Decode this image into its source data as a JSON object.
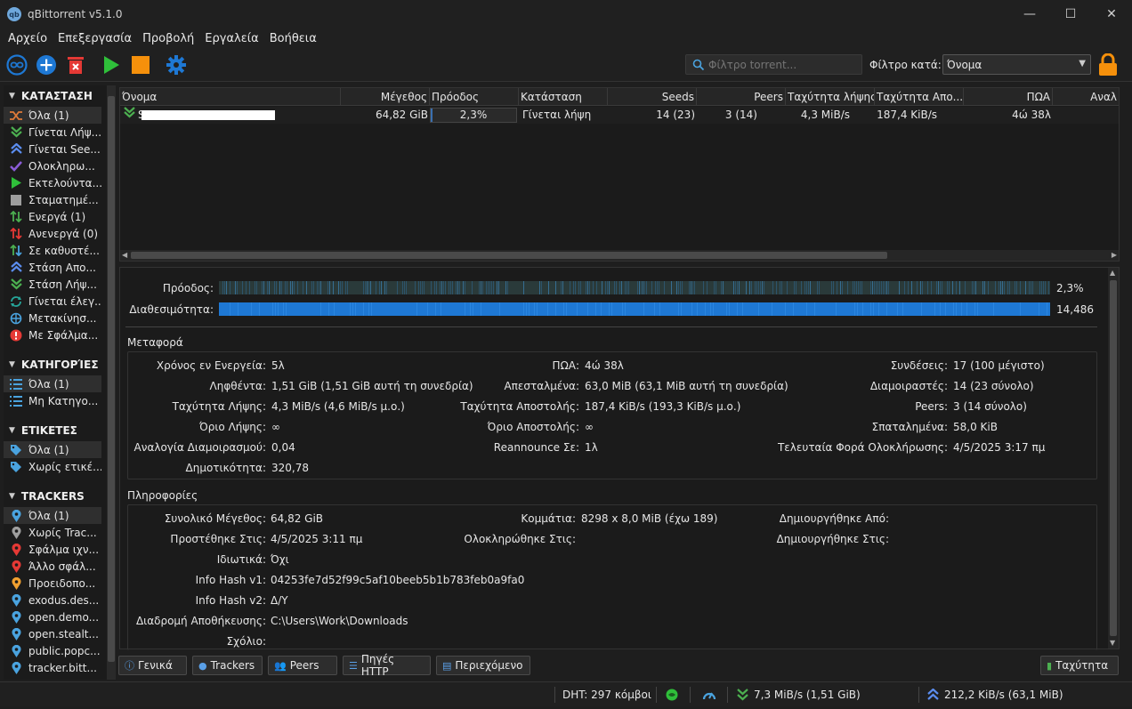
{
  "window": {
    "title": "qBittorrent v5.1.0",
    "icon_text": "qb",
    "minimize": "—",
    "maximize": "☐",
    "close": "✕"
  },
  "menu": [
    "Αρχείο",
    "Επεξεργασία",
    "Προβολή",
    "Εργαλεία",
    "Βοήθεια"
  ],
  "toolbar": {
    "search_placeholder": "Φίλτρο torrent...",
    "filter_label": "Φίλτρο κατά:",
    "filter_value": "Όνομα"
  },
  "sidebar": {
    "status_header": "ΚΑΤΑΣΤΑΣΗ",
    "status_items": [
      {
        "label": "Όλα (1)",
        "icon": "shuffle-icon",
        "color": "#e07b39"
      },
      {
        "label": "Γίνεται Λήψ...",
        "icon": "download-icon",
        "color": "#4caf50"
      },
      {
        "label": "Γίνεται See...",
        "icon": "upload-icon",
        "color": "#5b8def"
      },
      {
        "label": "Ολοκληρω...",
        "icon": "check-icon",
        "color": "#8a5cd6"
      },
      {
        "label": "Εκτελούντα...",
        "icon": "play-icon",
        "color": "#2fbf3a"
      },
      {
        "label": "Σταματημέ...",
        "icon": "stop-icon",
        "color": "#9e9e9e"
      },
      {
        "label": "Ενεργά (1)",
        "icon": "updown-active-icon",
        "color": "#4caf50"
      },
      {
        "label": "Ανενεργά (0)",
        "icon": "updown-inactive-icon",
        "color": "#e53935"
      },
      {
        "label": "Σε καθυστέ...",
        "icon": "updown-stalled-icon",
        "color": "#4aa3df"
      },
      {
        "label": "Στάση Απο...",
        "icon": "stalled-upload-icon",
        "color": "#5b8def"
      },
      {
        "label": "Στάση Λήψ...",
        "icon": "stalled-download-icon",
        "color": "#4caf50"
      },
      {
        "label": "Γίνεται έλεγ...",
        "icon": "refresh-icon",
        "color": "#26a69a"
      },
      {
        "label": "Μετακίνησ...",
        "icon": "move-icon",
        "color": "#4aa3df"
      },
      {
        "label": "Με Σφάλμα...",
        "icon": "error-icon",
        "color": "#e53935"
      }
    ],
    "categories_header": "ΚΑΤΗΓΟΡΊΕΣ",
    "category_items": [
      {
        "label": "Όλα (1)"
      },
      {
        "label": "Μη Κατηγο..."
      }
    ],
    "tags_header": "ΕΤΙΚΕΤΕΣ",
    "tag_items": [
      {
        "label": "Όλα (1)"
      },
      {
        "label": "Χωρίς ετικέ..."
      }
    ],
    "trackers_header": "TRACKERS",
    "tracker_items": [
      {
        "label": "Όλα (1)",
        "color": "#4aa3df"
      },
      {
        "label": "Χωρίς Trac...",
        "color": "#9e9e9e"
      },
      {
        "label": "Σφάλμα ιχν...",
        "color": "#e53935"
      },
      {
        "label": "Άλλο σφάλ...",
        "color": "#e53935"
      },
      {
        "label": "Προειδοπο...",
        "color": "#f0a030"
      },
      {
        "label": "exodus.des...",
        "color": "#4aa3df"
      },
      {
        "label": "open.demo...",
        "color": "#4aa3df"
      },
      {
        "label": "open.stealt...",
        "color": "#4aa3df"
      },
      {
        "label": "public.popc...",
        "color": "#4aa3df"
      },
      {
        "label": "tracker.bitt...",
        "color": "#4aa3df"
      }
    ]
  },
  "torrent_list": {
    "columns": [
      "Όνομα",
      "Μέγεθος",
      "Πρόοδος",
      "Κατάσταση",
      "Seeds",
      "Peers",
      "Ταχύτητα λήψης",
      "Ταχύτητα Απο...",
      "ΠΩΑ",
      "Αναλ"
    ],
    "rows": [
      {
        "name_prefix": "S",
        "size": "64,82 GiB",
        "progress": "2,3%",
        "progress_fraction": 0.023,
        "status": "Γίνεται λήψη",
        "seeds": "14 (23)",
        "peers": "3 (14)",
        "down_speed": "4,3 MiB/s",
        "up_speed": "187,4 KiB/s",
        "eta": "4ώ 38λ"
      }
    ]
  },
  "details": {
    "progress_label": "Πρόοδος:",
    "progress_value": "2,3%",
    "availability_label": "Διαθεσιμότητα:",
    "availability_value": "14,486",
    "transfer_title": "Μεταφορά",
    "transfer": {
      "col1": [
        {
          "label": "Χρόνος εν Ενεργεία:",
          "value": "5λ"
        },
        {
          "label": "Ληφθέντα:",
          "value": "1,51 GiB (1,51 GiB αυτή τη συνεδρία)"
        },
        {
          "label": "Ταχύτητα Λήψης:",
          "value": "4,3 MiB/s (4,6 MiB/s μ.ο.)"
        },
        {
          "label": "Όριο Λήψης:",
          "value": "∞"
        },
        {
          "label": "Αναλογία Διαμοιρασμού:",
          "value": "0,04"
        },
        {
          "label": "Δημοτικότητα:",
          "value": "320,78"
        }
      ],
      "col2": [
        {
          "label": "ΠΩΑ:",
          "value": "4ώ 38λ"
        },
        {
          "label": "Απεσταλμένα:",
          "value": "63,0 MiB (63,1 MiB αυτή τη συνεδρία)"
        },
        {
          "label": "Ταχύτητα Αποστολής:",
          "value": "187,4 KiB/s (193,3 KiB/s μ.ο.)"
        },
        {
          "label": "Όριο Αποστολής:",
          "value": "∞"
        },
        {
          "label": "Reannounce Σε:",
          "value": "1λ"
        }
      ],
      "col3": [
        {
          "label": "Συνδέσεις:",
          "value": "17 (100 μέγιστο)"
        },
        {
          "label": "Διαμοιραστές:",
          "value": "14 (23 σύνολο)"
        },
        {
          "label": "Peers:",
          "value": "3 (14 σύνολο)"
        },
        {
          "label": "Σπαταλημένα:",
          "value": "58,0 KiB"
        },
        {
          "label": "Τελευταία Φορά Ολοκλήρωσης:",
          "value": "4/5/2025 3:17 πμ"
        }
      ]
    },
    "info_title": "Πληροφορίες",
    "info": {
      "col1": [
        {
          "label": "Συνολικό Μέγεθος:",
          "value": "64,82 GiB"
        },
        {
          "label": "Προστέθηκε Στις:",
          "value": "4/5/2025 3:11 πμ"
        },
        {
          "label": "Ιδιωτικά:",
          "value": "Όχι"
        },
        {
          "label": "Info Hash v1:",
          "value": "04253fe7d52f99c5af10beeb5b1b783feb0a9fa0"
        },
        {
          "label": "Info Hash v2:",
          "value": "Δ/Υ"
        },
        {
          "label": "Διαδρομή Αποθήκευσης:",
          "value": "C:\\Users\\Work\\Downloads"
        },
        {
          "label": "Σχόλιο:",
          "value": ""
        }
      ],
      "col2": [
        {
          "label": "Κομμάτια:",
          "value": "8298 x 8,0 MiB (έχω 189)"
        },
        {
          "label": "Ολοκληρώθηκε Στις:",
          "value": ""
        }
      ],
      "col3": [
        {
          "label": "Δημιουργήθηκε Από:",
          "value": ""
        },
        {
          "label": "Δημιουργήθηκε Στις:",
          "value": ""
        }
      ]
    }
  },
  "tabs": {
    "general": "Γενικά",
    "trackers": "Trackers",
    "peers": "Peers",
    "http": "Πηγές HTTP",
    "content": "Περιεχόμενο",
    "speed": "Ταχύτητα"
  },
  "statusbar": {
    "dht": "DHT: 297 κόμβοι",
    "download": "7,3 MiB/s (1,51 GiB)",
    "upload": "212,2 KiB/s (63,1 MiB)"
  },
  "colors": {
    "accent_blue": "#1e78d4",
    "download_green": "#4caf50",
    "upload_blue": "#5b8def"
  }
}
